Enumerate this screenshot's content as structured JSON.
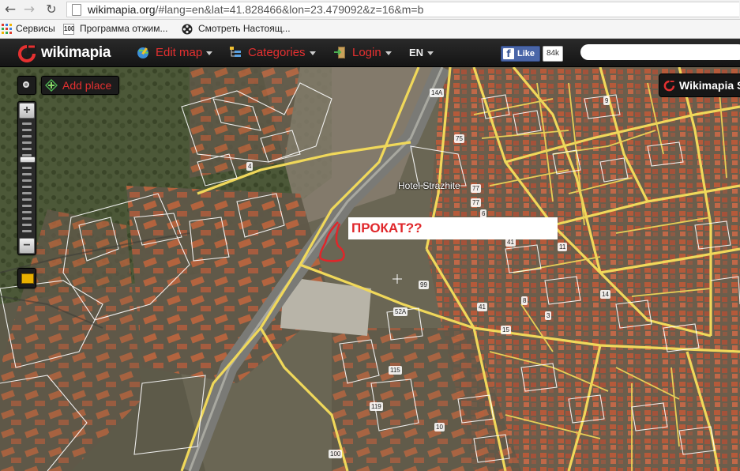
{
  "browser": {
    "url_host": "wikimapia.org",
    "url_rest": "/#lang=en&lat=41.828466&lon=23.479092&z=16&m=b",
    "bookmarks": [
      {
        "label": "Сервисы",
        "icon": "apps-grid-icon"
      },
      {
        "label": "Программа отжим...",
        "icon": "page-icon"
      },
      {
        "label": "Смотреть Настоящ...",
        "icon": "film-reel-icon"
      }
    ]
  },
  "toolbar": {
    "logo_text": "wikimapia",
    "edit_map": "Edit map",
    "categories": "Categories",
    "login": "Login",
    "language": "EN",
    "fb_like": "Like",
    "fb_count": "84k",
    "search_value": ""
  },
  "map_controls": {
    "add_place": "Add place",
    "zoom_in": "+",
    "zoom_out": "−",
    "zoom_level_fraction": 0.33,
    "side_tab": "Wikimapia S"
  },
  "annotations": {
    "prokat": "ПРОКАТ??",
    "hotel": "Hotel Strazhite"
  },
  "map_numbers": [
    "14A",
    "75",
    "77",
    "77",
    "6",
    "41",
    "11",
    "99",
    "41",
    "52A",
    "15",
    "115",
    "119",
    "100",
    "4",
    "3",
    "14",
    "8",
    "9",
    "10"
  ],
  "colors": {
    "accent_red": "#e53030",
    "road_yellow": "#f0d85a",
    "toolbar_bg": "#1c1c1c"
  }
}
